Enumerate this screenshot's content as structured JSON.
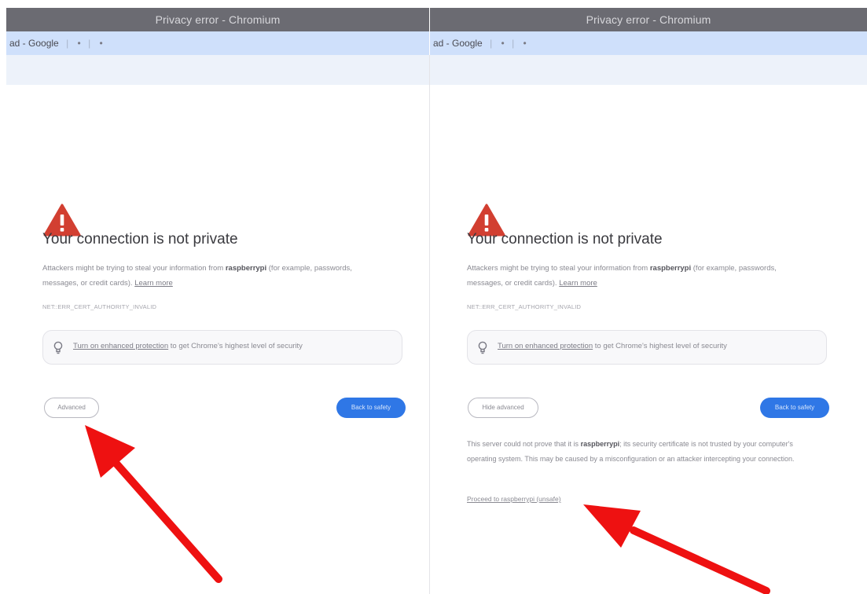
{
  "left_panel": {
    "window_title": "Privacy error - Chromium",
    "tab_label": "ad - Google",
    "tab_glyphs": [
      "|",
      "•",
      "|",
      "•"
    ],
    "heading": "Your connection is not private",
    "desc_prefix": "Attackers might be trying to steal your information from ",
    "desc_host": "raspberrypi",
    "desc_suffix": " (for example, passwords, messages, or credit cards). ",
    "learn_more": "Learn more",
    "error_code": "NET::ERR_CERT_AUTHORITY_INVALID",
    "enhanced_link": "Turn on enhanced protection",
    "enhanced_suffix": " to get Chrome's highest level of security",
    "advanced_button": "Advanced",
    "back_button": "Back to safety"
  },
  "right_panel": {
    "window_title": "Privacy error - Chromium",
    "tab_label": "ad - Google",
    "tab_glyphs": [
      "|",
      "•",
      "|",
      "•"
    ],
    "heading": "Your connection is not private",
    "desc_prefix": "Attackers might be trying to steal your information from ",
    "desc_host": "raspberrypi",
    "desc_suffix": " (for example, passwords, messages, or credit cards). ",
    "learn_more": "Learn more",
    "error_code": "NET::ERR_CERT_AUTHORITY_INVALID",
    "enhanced_link": "Turn on enhanced protection",
    "enhanced_suffix": " to get Chrome's highest level of security",
    "hide_advanced_button": "Hide advanced",
    "back_button": "Back to safety",
    "adv_prefix": "This server could not prove that it is ",
    "adv_host": "raspberrypi",
    "adv_suffix": "; its security certificate is not trusted by your computer's operating system. This may be caused by a misconfiguration or an attacker intercepting your connection.",
    "proceed_link": "Proceed to raspberrypi (unsafe)"
  },
  "colors": {
    "warning_red": "#d23f31",
    "arrow_red": "#ee1111",
    "primary_blue": "#2f77e6",
    "title_bar": "#6b6b72",
    "tab_strip": "#cfe0fb"
  },
  "icons": {
    "warning": "warning-triangle-icon",
    "bulb": "lightbulb-icon",
    "arrow": "red-arrow-annotation"
  }
}
